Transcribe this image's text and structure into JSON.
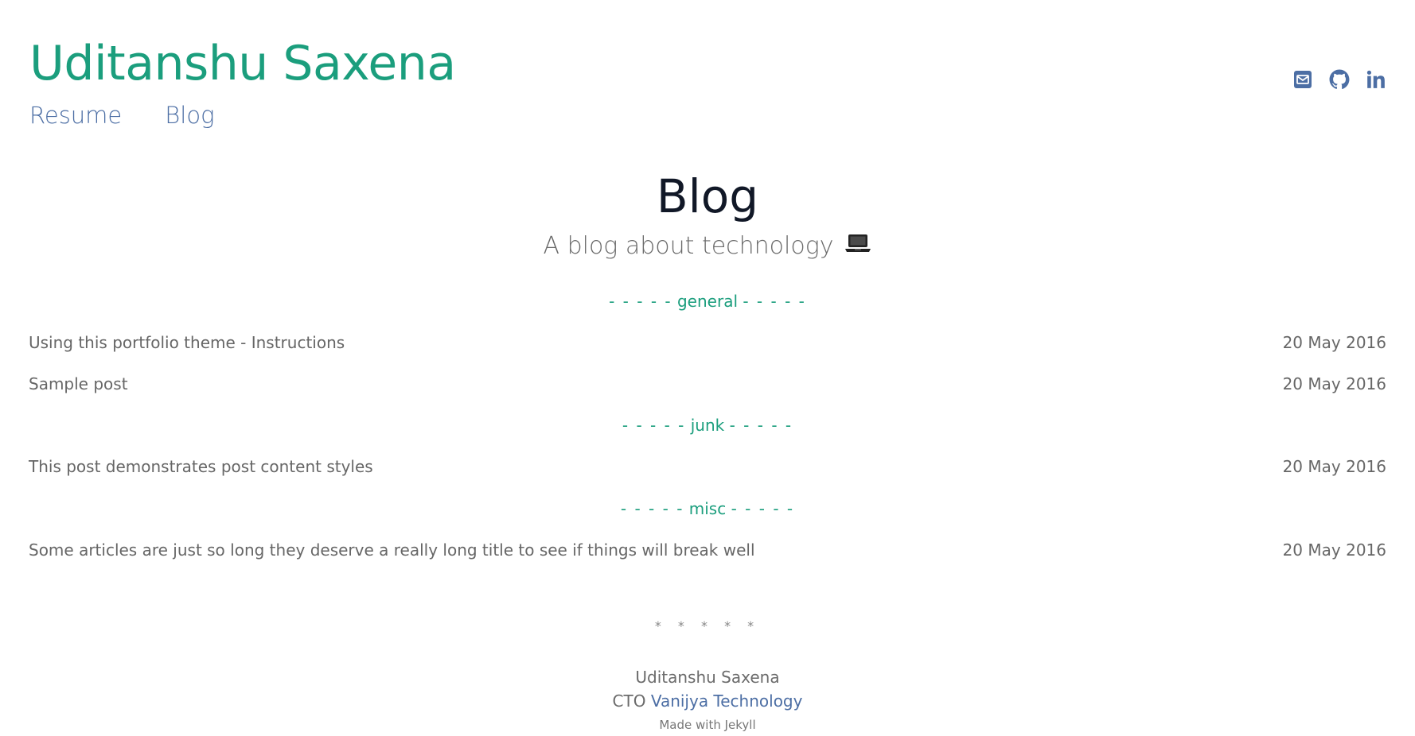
{
  "site": {
    "title": "Uditanshu Saxena",
    "nav": [
      "Resume",
      "Blog"
    ],
    "accent_color": "#1b9e7d",
    "link_color": "#4c6ea4"
  },
  "social": {
    "icons": [
      "envelope-icon",
      "github-icon",
      "linkedin-icon"
    ]
  },
  "page": {
    "title": "Blog",
    "subtitle": "A blog about technology",
    "subtitle_icon": "laptop-icon"
  },
  "categories": [
    {
      "name": "general",
      "dashes": "- - - - -",
      "posts": [
        {
          "title": "Using this portfolio theme - Instructions",
          "date": "20 May 2016"
        },
        {
          "title": "Sample post",
          "date": "20 May 2016"
        }
      ]
    },
    {
      "name": "junk",
      "dashes": "- - - - -",
      "posts": [
        {
          "title": "This post demonstrates post content styles",
          "date": "20 May 2016"
        }
      ]
    },
    {
      "name": "misc",
      "dashes": "- - - - -",
      "posts": [
        {
          "title": "Some articles are just so long they deserve a really long title to see if things will break well",
          "date": "20 May 2016"
        }
      ]
    }
  ],
  "divider": "* * * * *",
  "footer": {
    "name": "Uditanshu Saxena",
    "role_prefix": "CTO",
    "company": "Vanijya Technology",
    "made_with": "Made with Jekyll"
  }
}
